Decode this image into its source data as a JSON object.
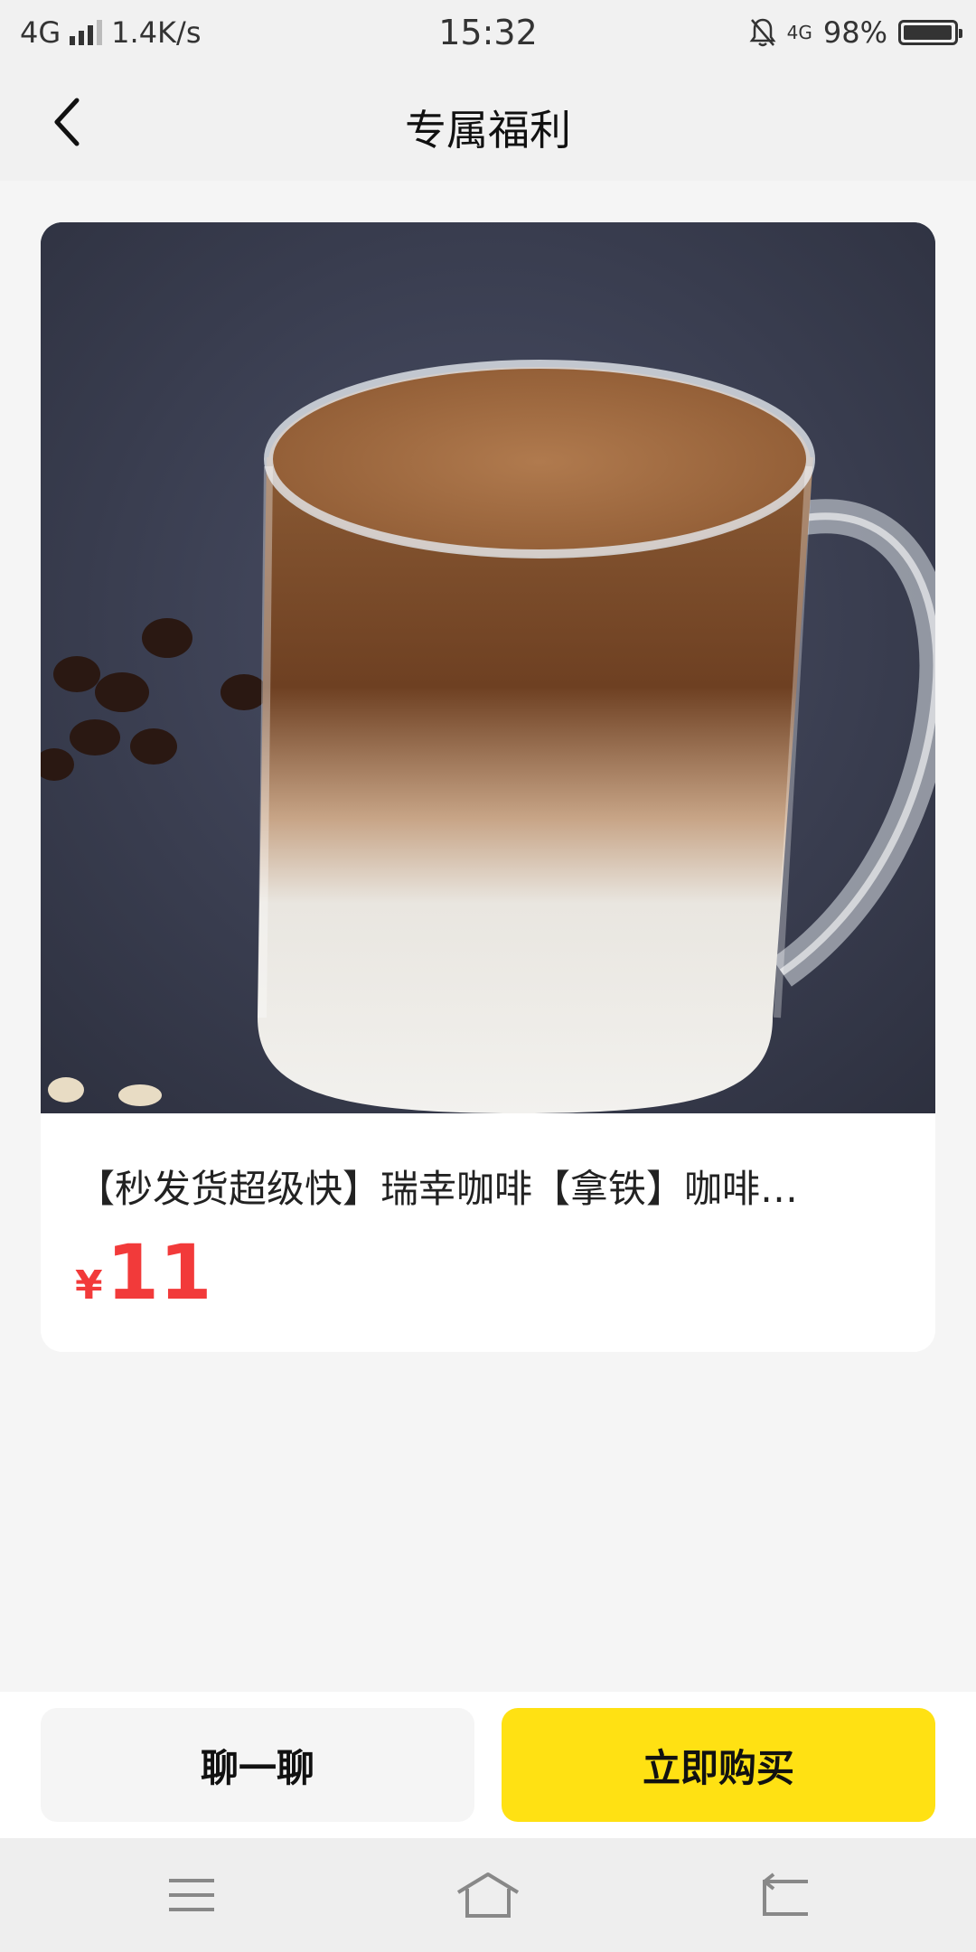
{
  "status_bar": {
    "network": "4G",
    "speed": "1.4K/s",
    "time": "15:32",
    "network_right": "4G",
    "battery": "98%",
    "battery_level": 0.98
  },
  "header": {
    "title": "专属福利",
    "back_icon": "chevron-left-icon"
  },
  "product": {
    "title": "【秒发货超级快】瑞幸咖啡【拿铁】咖啡…",
    "price_symbol": "¥",
    "price": "11",
    "image": "latte-glass-mug-photo"
  },
  "actions": {
    "chat_label": "聊一聊",
    "buy_label": "立即购买"
  },
  "colors": {
    "accent": "#ffe113",
    "price": "#f23a3a",
    "background": "#f5f5f5"
  },
  "nav_bar": {
    "icons": [
      "menu-icon",
      "home-icon",
      "back-icon"
    ]
  }
}
